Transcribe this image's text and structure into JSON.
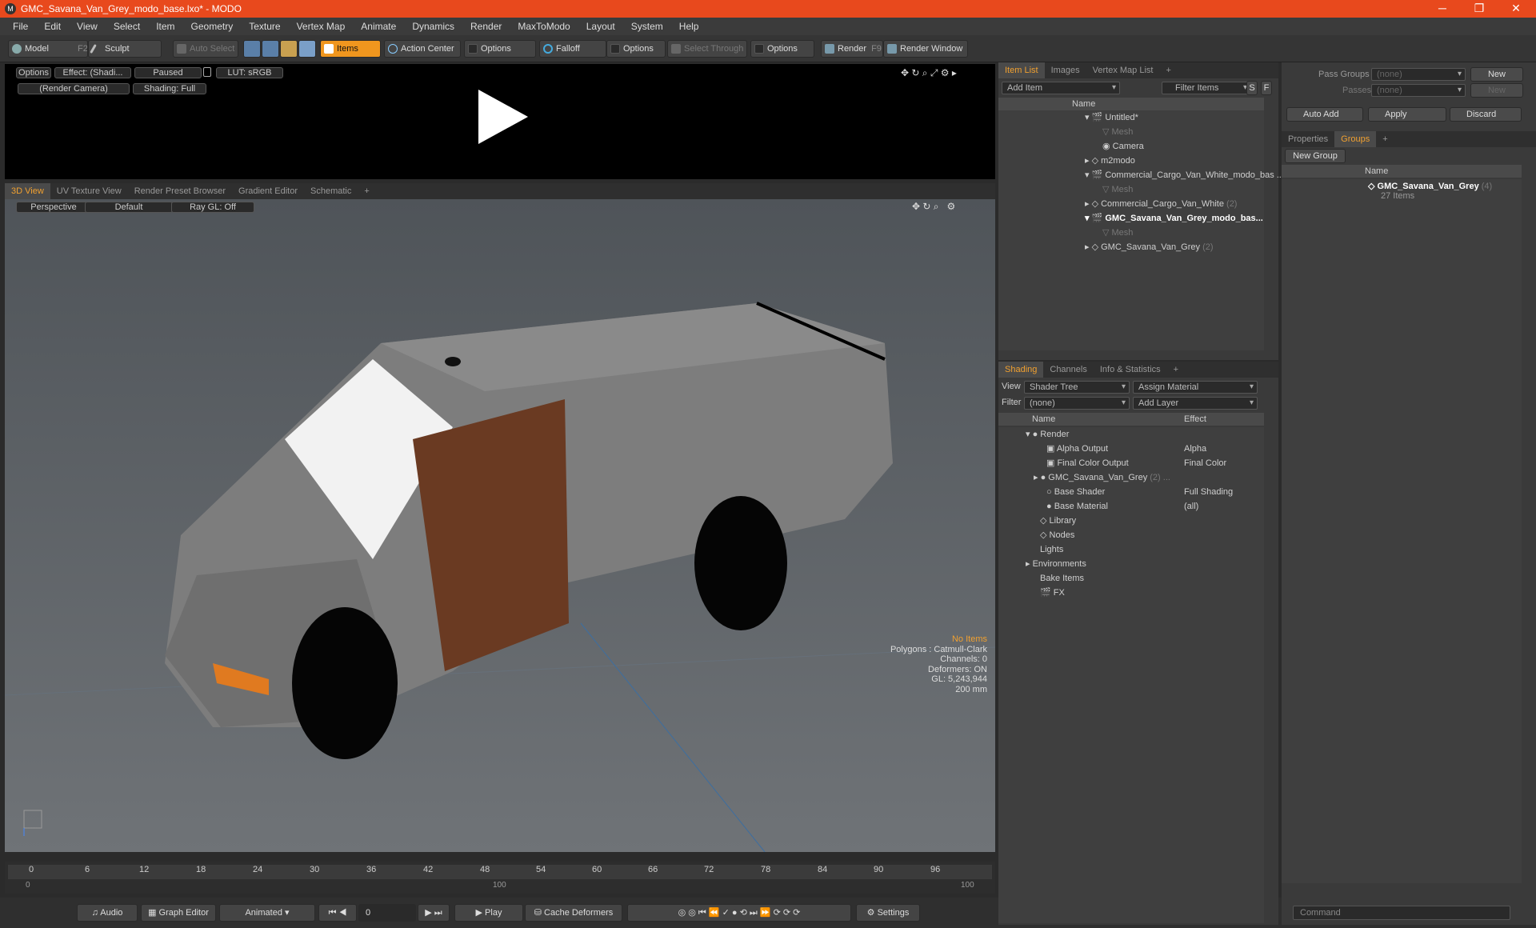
{
  "window": {
    "title": "GMC_Savana_Van_Grey_modo_base.lxo* - MODO",
    "minimize": "─",
    "maximize": "❐",
    "close": "✕"
  },
  "menu": [
    "File",
    "Edit",
    "View",
    "Select",
    "Item",
    "Geometry",
    "Texture",
    "Vertex Map",
    "Animate",
    "Dynamics",
    "Render",
    "MaxToModo",
    "Layout",
    "System",
    "Help"
  ],
  "toolbar": {
    "model": "Model",
    "model_key": "F2",
    "sculpt": "Sculpt",
    "auto_select": "Auto Select",
    "items": "Items",
    "action_center": "Action Center",
    "options1": "Options",
    "falloff": "Falloff",
    "options2": "Options",
    "select_through": "Select Through",
    "options3": "Options",
    "render": "Render",
    "render_key": "F9",
    "render_window": "Render Window"
  },
  "preview": {
    "options": "Options",
    "effect": "Effect: (Shadi...",
    "paused": "Paused",
    "lut": "LUT: sRGB",
    "camera": "(Render Camera)",
    "shading": "Shading: Full"
  },
  "viewport": {
    "tabs": [
      "3D View",
      "UV Texture View",
      "Render Preset Browser",
      "Gradient Editor",
      "Schematic"
    ],
    "perspective": "Perspective",
    "default": "Default",
    "raygl": "Ray GL: Off",
    "info": {
      "no_items": "No Items",
      "polygons": "Polygons : Catmull-Clark",
      "channels": "Channels: 0",
      "deformers": "Deformers: ON",
      "gl": "GL: 5,243,944",
      "scale": "200 mm"
    }
  },
  "timeline": {
    "ticks": [
      "0",
      "6",
      "12",
      "18",
      "24",
      "30",
      "36",
      "42",
      "48",
      "54",
      "60",
      "66",
      "72",
      "78",
      "84",
      "90",
      "96"
    ],
    "sub_ticks": [
      "0",
      "100"
    ]
  },
  "bottom": {
    "audio": "Audio",
    "graph_editor": "Graph Editor",
    "animated": "Animated",
    "frame": "0",
    "play": "Play",
    "cache": "Cache Deformers",
    "settings": "Settings"
  },
  "itemlist": {
    "tabs": [
      "Item List",
      "Images",
      "Vertex Map List"
    ],
    "add_item": "Add Item",
    "filter": "Filter Items",
    "s": "S",
    "f": "F",
    "name_col": "Name",
    "rows": [
      {
        "label": "Untitled*",
        "dim": false,
        "bold": false
      },
      {
        "label": "Mesh",
        "dim": true,
        "bold": false
      },
      {
        "label": "Camera",
        "dim": false,
        "bold": false
      },
      {
        "label": "m2modo",
        "dim": false,
        "bold": false
      },
      {
        "label": "Commercial_Cargo_Van_White_modo_bas ...",
        "dim": false,
        "bold": false
      },
      {
        "label": "Mesh",
        "dim": true,
        "bold": false
      },
      {
        "label": "Commercial_Cargo_Van_White",
        "count": "(2)",
        "dim": false,
        "bold": false
      },
      {
        "label": "GMC_Savana_Van_Grey_modo_bas...",
        "dim": false,
        "bold": true
      },
      {
        "label": "Mesh",
        "dim": true,
        "bold": false
      },
      {
        "label": "GMC_Savana_Van_Grey",
        "count": "(2)",
        "dim": false,
        "bold": false
      }
    ]
  },
  "shading": {
    "tabs": [
      "Shading",
      "Channels",
      "Info & Statistics"
    ],
    "view_label": "View",
    "view_value": "Shader Tree",
    "assign": "Assign Material",
    "filter_label": "Filter",
    "filter_value": "(none)",
    "add_layer": "Add Layer",
    "name_col": "Name",
    "effect_col": "Effect",
    "rows": [
      {
        "label": "Render",
        "effect": ""
      },
      {
        "label": "Alpha Output",
        "effect": "Alpha"
      },
      {
        "label": "Final Color Output",
        "effect": "Final Color"
      },
      {
        "label": "GMC_Savana_Van_Grey",
        "count": "(2) ...",
        "effect": ""
      },
      {
        "label": "Base Shader",
        "effect": "Full Shading"
      },
      {
        "label": "Base Material",
        "effect": "(all)"
      },
      {
        "label": "Library",
        "effect": ""
      },
      {
        "label": "Nodes",
        "effect": ""
      },
      {
        "label": "Lights",
        "effect": ""
      },
      {
        "label": "Environments",
        "effect": ""
      },
      {
        "label": "Bake Items",
        "effect": ""
      },
      {
        "label": "FX",
        "effect": ""
      }
    ]
  },
  "groups": {
    "pass_groups_label": "Pass Groups",
    "pass_groups_value": "(none)",
    "passes_label": "Passes",
    "passes_value": "(none)",
    "new1": "New",
    "new2": "New",
    "auto_add": "Auto Add",
    "apply": "Apply",
    "discard": "Discard",
    "tabs": [
      "Properties",
      "Groups"
    ],
    "new_group": "New Group",
    "name_col": "Name",
    "group_name": "GMC_Savana_Van_Grey",
    "group_count": "(4)",
    "group_items": "27 Items"
  },
  "command": {
    "placeholder": "Command"
  }
}
